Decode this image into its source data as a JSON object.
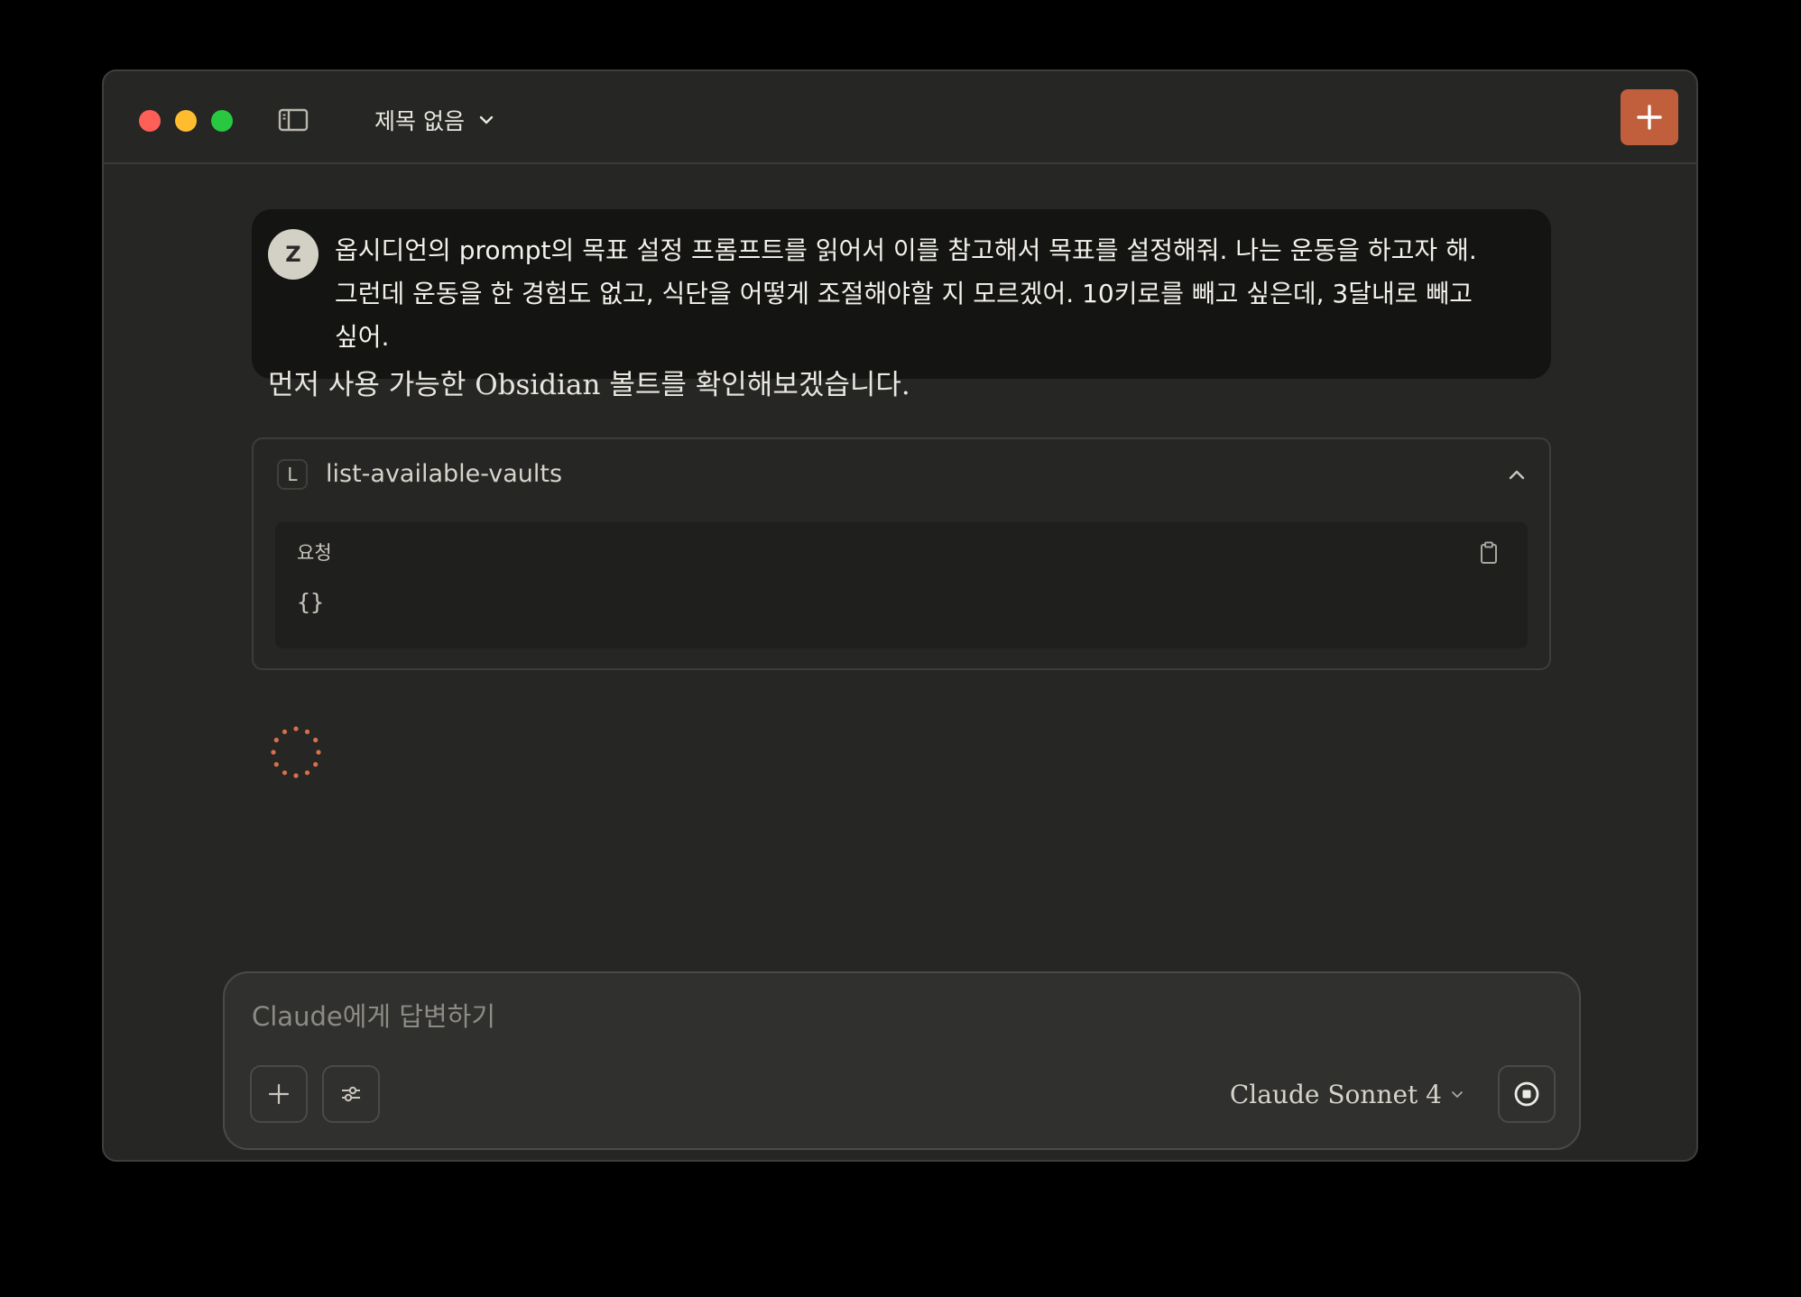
{
  "titlebar": {
    "title": "제목 없음",
    "sidebar_toggle_icon": "sidebar-toggle-icon",
    "new_chat_icon": "plus-icon",
    "accent_color": "#c15f3c"
  },
  "conversation": {
    "user_message": {
      "avatar_initial": "Z",
      "text": "옵시디언의 prompt의 목표 설정 프롬프트를 읽어서 이를 참고해서 목표를 설정해줘. 나는 운동을 하고자 해. 그런데 운동을 한 경험도 없고, 식단을 어떻게 조절해야할 지 모르겠어. 10키로를 빼고 싶은데, 3달내로 빼고 싶어."
    },
    "assistant_message": {
      "text": "먼저 사용 가능한 Obsidian 볼트를 확인해보겠습니다."
    },
    "tool_call": {
      "icon_letter": "L",
      "name": "list-available-vaults",
      "request_label": "요청",
      "request_body": "{}"
    }
  },
  "composer": {
    "placeholder": "Claude에게 답변하기",
    "value": "",
    "model": "Claude Sonnet 4"
  }
}
